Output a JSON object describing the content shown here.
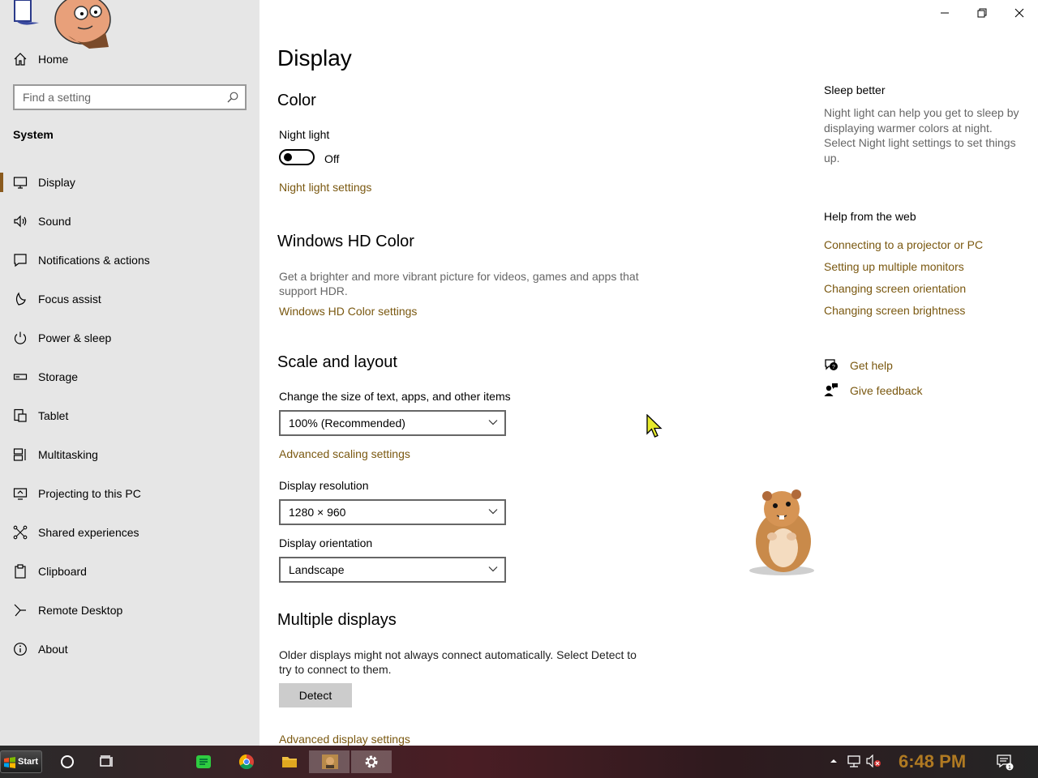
{
  "window": {
    "minimize": "minimize",
    "maximize": "restore",
    "close": "close"
  },
  "sidebar": {
    "home_label": "Home",
    "search_placeholder": "Find a setting",
    "section_title": "System",
    "items": [
      {
        "label": "Display",
        "icon": "monitor-icon",
        "active": true
      },
      {
        "label": "Sound",
        "icon": "speaker-icon"
      },
      {
        "label": "Notifications & actions",
        "icon": "notification-icon"
      },
      {
        "label": "Focus assist",
        "icon": "moon-icon"
      },
      {
        "label": "Power & sleep",
        "icon": "power-icon"
      },
      {
        "label": "Storage",
        "icon": "storage-icon"
      },
      {
        "label": "Tablet",
        "icon": "tablet-icon"
      },
      {
        "label": "Multitasking",
        "icon": "multitasking-icon"
      },
      {
        "label": "Projecting to this PC",
        "icon": "projecting-icon"
      },
      {
        "label": "Shared experiences",
        "icon": "shared-icon"
      },
      {
        "label": "Clipboard",
        "icon": "clipboard-icon"
      },
      {
        "label": "Remote Desktop",
        "icon": "remote-icon"
      },
      {
        "label": "About",
        "icon": "info-icon"
      }
    ]
  },
  "main": {
    "title": "Display",
    "color": {
      "heading": "Color",
      "night_light_label": "Night light",
      "night_light_state": "Off",
      "night_light_link": "Night light settings"
    },
    "hdr": {
      "heading": "Windows HD Color",
      "desc_line1": "Get a brighter and more vibrant picture for videos, games and apps that",
      "desc_line2": "support HDR.",
      "link": "Windows HD Color settings"
    },
    "scale": {
      "heading": "Scale and layout",
      "size_label": "Change the size of text, apps, and other items",
      "size_value": "100% (Recommended)",
      "advanced_link": "Advanced scaling settings",
      "resolution_label": "Display resolution",
      "resolution_value": "1280 × 960",
      "orientation_label": "Display orientation",
      "orientation_value": "Landscape"
    },
    "multiple": {
      "heading": "Multiple displays",
      "desc_line1": "Older displays might not always connect automatically. Select Detect to",
      "desc_line2": "try to connect to them.",
      "detect_button": "Detect",
      "advanced_link": "Advanced display settings"
    }
  },
  "right": {
    "sleep_title": "Sleep better",
    "sleep_desc": "Night light can help you get to sleep by displaying warmer colors at night. Select Night light settings to set things up.",
    "help_title": "Help from the web",
    "links": [
      "Connecting to a projector or PC",
      "Setting up multiple monitors",
      "Changing screen orientation",
      "Changing screen brightness"
    ],
    "get_help": "Get help",
    "give_feedback": "Give feedback"
  },
  "taskbar": {
    "start_label": "Start",
    "clock": "6:48 PM",
    "notification_count": "1"
  },
  "colors": {
    "link": "#7a5810",
    "accent": "#8a5a1e",
    "sidebar_bg": "#e6e6e6"
  }
}
